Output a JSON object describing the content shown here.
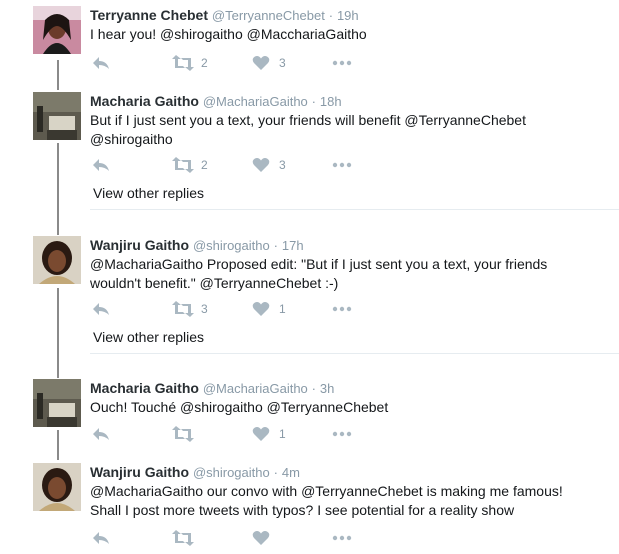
{
  "tweets": [
    {
      "name": "Terryanne Chebet",
      "handle": "@TerryanneChebet",
      "time": "19h",
      "text": "I hear you! @shirogaitho @MacchariaGaitho",
      "retweets": "2",
      "likes": "3"
    },
    {
      "name": "Macharia Gaitho",
      "handle": "@MachariaGaitho",
      "time": "18h",
      "text": "But if I just sent you a text, your friends will benefit  @TerryanneChebet @shirogaitho",
      "retweets": "2",
      "likes": "3",
      "view_other": "View other replies"
    },
    {
      "name": "Wanjiru Gaitho",
      "handle": "@shirogaitho",
      "time": "17h",
      "text": "@MachariaGaitho Proposed edit: \"But if I just sent you a text, your friends wouldn't benefit.\" @TerryanneChebet :-)",
      "retweets": "3",
      "likes": "1",
      "view_other": "View other replies"
    },
    {
      "name": "Macharia Gaitho",
      "handle": "@MachariaGaitho",
      "time": "3h",
      "text": "Ouch! Touché @shirogaitho @TerryanneChebet",
      "retweets": "",
      "likes": "1"
    },
    {
      "name": "Wanjiru Gaitho",
      "handle": "@shirogaitho",
      "time": "4m",
      "text": "@MachariaGaitho our convo with @TerryanneChebet is making me famous! Shall I post more tweets with typos? I see potential for a reality show",
      "retweets": "",
      "likes": ""
    }
  ],
  "separator": "·",
  "colors": {
    "name": "#292f33",
    "meta": "#8899a6",
    "icon": "#aab8c2",
    "thread_line": "#8a8a8a"
  }
}
